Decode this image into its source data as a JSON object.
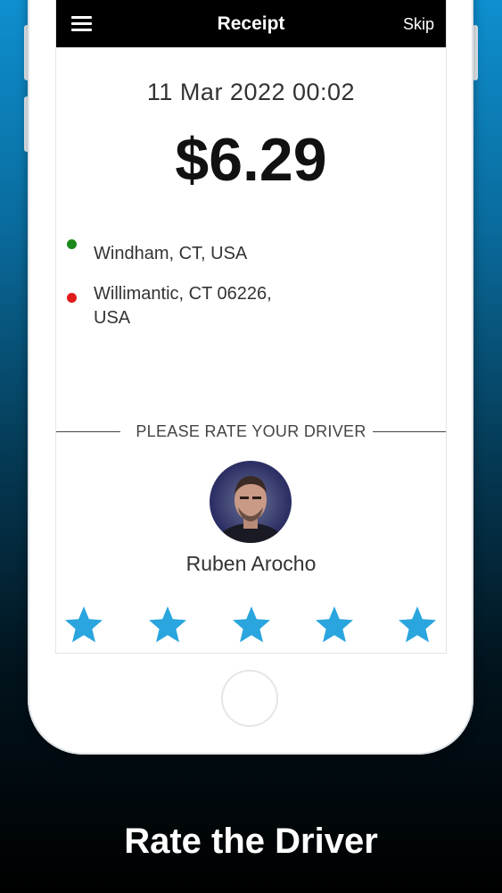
{
  "header": {
    "title": "Receipt",
    "skip_label": "Skip"
  },
  "receipt": {
    "datetime": "11 Mar 2022 00:02",
    "amount": "$6.29",
    "pickup": {
      "address": "Windham, CT, USA",
      "dot_color": "#1b8a1b"
    },
    "dropoff": {
      "address_line1": "Willimantic, CT 06226,",
      "address_line2": "USA",
      "dot_color": "#e01b1b"
    }
  },
  "rating": {
    "prompt": "PLEASE RATE YOUR DRIVER",
    "driver_name": "Ruben Arocho",
    "max_stars": 5,
    "star_color": "#2aa5de"
  },
  "caption": "Rate the Driver",
  "icons": [
    "menu-icon",
    "star-icon",
    "avatar-photo",
    "home-button"
  ]
}
